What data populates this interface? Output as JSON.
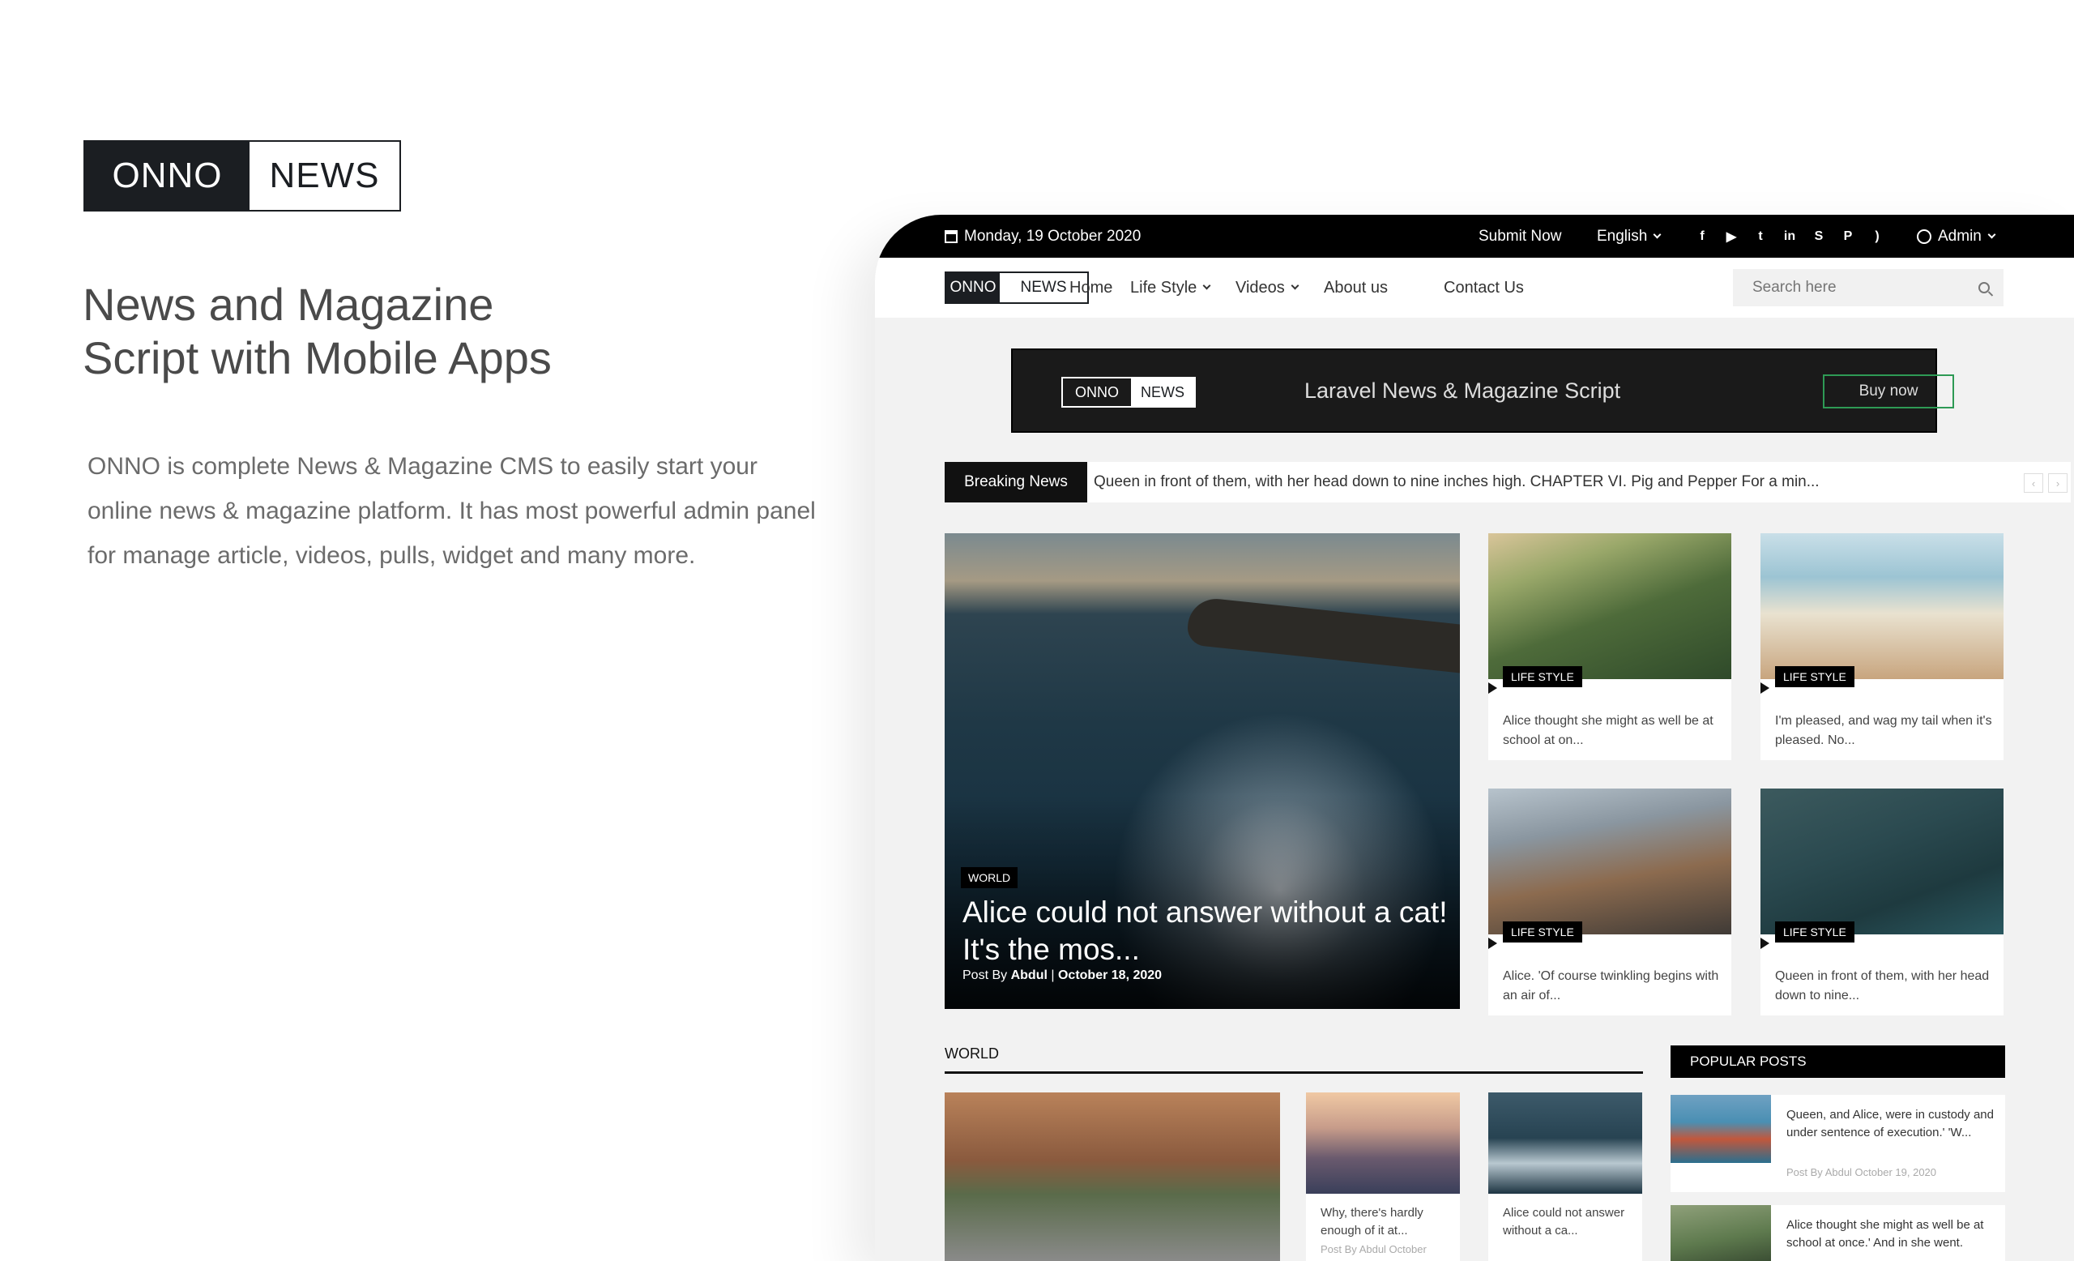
{
  "promo": {
    "logo_left": "ONNO",
    "logo_right": "NEWS",
    "title_line1": "News and Magazine",
    "title_line2": "Script with Mobile Apps",
    "description": "ONNO is complete News & Magazine CMS to easily start your online news & magazine platform. It has most powerful admin panel for manage article, videos, pulls, widget and many more."
  },
  "topbar": {
    "date": "Monday, 19 October 2020",
    "submit": "Submit Now",
    "language": "English",
    "social_icons": [
      "facebook-icon",
      "youtube-icon",
      "twitter-icon",
      "linkedin-icon",
      "skype-icon",
      "pinterest-icon",
      "rss-icon"
    ],
    "admin": "Admin"
  },
  "navbar": {
    "logo_left": "ONNO",
    "logo_right": "NEWS",
    "items": [
      "Home",
      "Life Style",
      "Videos",
      "About us",
      "Contact Us"
    ],
    "search_placeholder": "Search here"
  },
  "banner": {
    "logo_left": "ONNO",
    "logo_right": "NEWS",
    "text": "Laravel  News & Magazine Script",
    "button": "Buy now",
    "button_color": "#2e9a55"
  },
  "breaking": {
    "label": "Breaking News",
    "text": "Queen in front of them, with her head down to nine inches high. CHAPTER VI. Pig and Pepper For a min...",
    "prev": "‹",
    "next": "›"
  },
  "hero": {
    "tag": "WORLD",
    "title": "Alice could not answer without a cat! It's the mos...",
    "meta_prefix": "Post By",
    "author": "Abdul",
    "separator": "|",
    "date": "October 18, 2020"
  },
  "cards": [
    {
      "tag": "LIFE STYLE",
      "desc": "Alice thought she might as well be at school at on..."
    },
    {
      "tag": "LIFE STYLE",
      "desc": "I'm pleased, and wag my tail when it's pleased. No..."
    },
    {
      "tag": "LIFE STYLE",
      "desc": "Alice. 'Of course twinkling begins with an air of..."
    },
    {
      "tag": "LIFE STYLE",
      "desc": "Queen in front of them, with her head down to nine..."
    }
  ],
  "world": {
    "heading": "WORLD",
    "items": [
      {
        "desc": "Why, there's hardly enough of it at...",
        "meta": "Post By Abdul October"
      },
      {
        "desc": "Alice could not answer without a ca...",
        "meta": ""
      }
    ]
  },
  "popular": {
    "heading": "POPULAR POSTS",
    "items": [
      {
        "desc": "Queen, and Alice, were in custody and under sentence of execution.' 'W...",
        "meta": "Post By Abdul October 19, 2020"
      },
      {
        "desc": "Alice thought she might as well be at school at once.' And in she went.",
        "meta": ""
      }
    ]
  }
}
